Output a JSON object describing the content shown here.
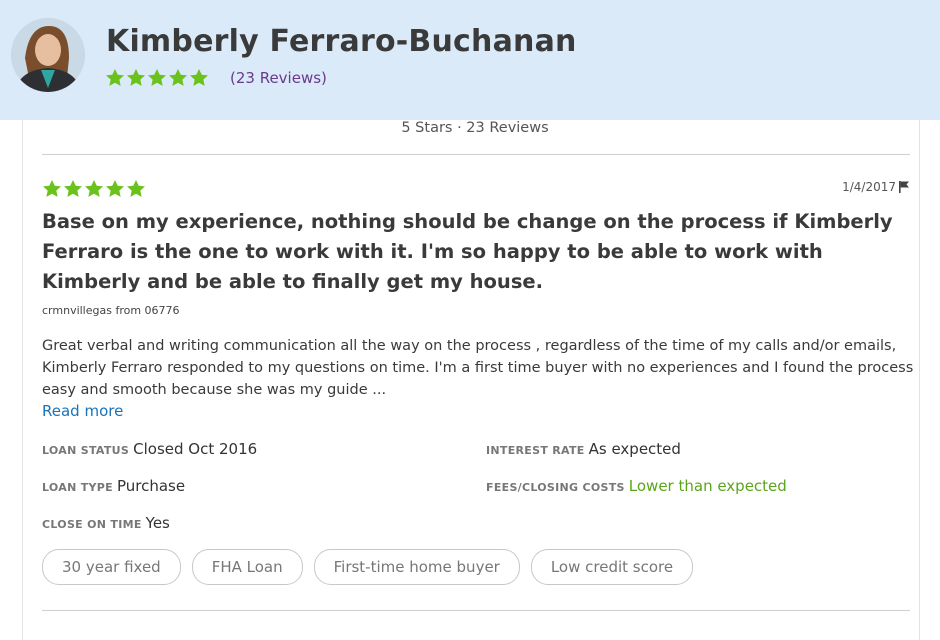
{
  "header": {
    "name": "Kimberly Ferraro-Buchanan",
    "rating_stars": 5,
    "reviews_link": "(23 Reviews)"
  },
  "summary": "5 Stars · 23 Reviews",
  "review": {
    "rating_stars": 5,
    "date": "1/4/2017",
    "title": "Base on my experience, nothing should be change on the process if Kimberly Ferraro is the one to work with it. I'm so happy to be able to work with Kimberly and be able to finally get my house.",
    "reviewer": "crmnvillegas from 06776",
    "body": "Great verbal and writing communication all the way on the process , regardless of the time of my calls and/or emails, Kimberly Ferraro responded to my questions on time. I'm a first time buyer with no experiences and I found the process easy and smooth because she was my guide ...",
    "read_more": "Read more",
    "details": {
      "loan_status_label": "LOAN STATUS",
      "loan_status": "Closed Oct 2016",
      "interest_rate_label": "INTEREST RATE",
      "interest_rate": "As expected",
      "loan_type_label": "LOAN TYPE",
      "loan_type": "Purchase",
      "fees_label": "FEES/CLOSING COSTS",
      "fees": "Lower than expected",
      "close_on_time_label": "CLOSE ON TIME",
      "close_on_time": "Yes"
    },
    "tags": [
      "30 year fixed",
      "FHA Loan",
      "First-time home buyer",
      "Low credit score"
    ]
  },
  "colors": {
    "header_bg": "#daeaf8",
    "star": "#6cc21c",
    "link": "#1a73b8",
    "positive": "#5aa51c"
  },
  "icons": [
    "star-icon",
    "flag-icon"
  ]
}
